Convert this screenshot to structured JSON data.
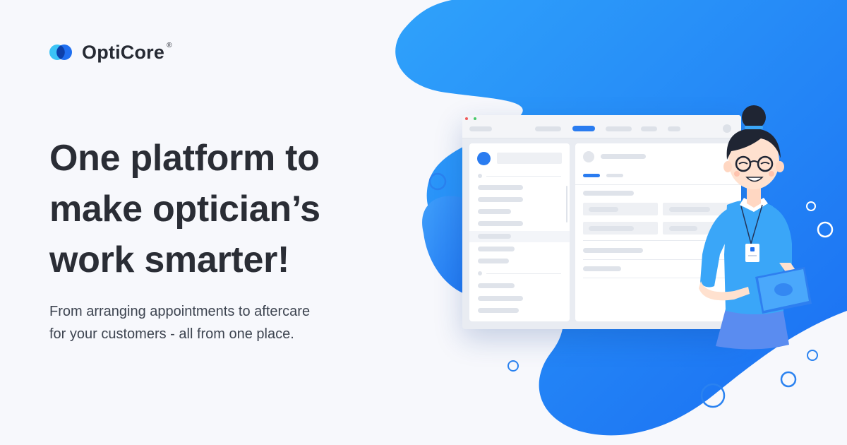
{
  "brand": {
    "name": "OptiCore",
    "registered_mark": "®",
    "logo_colors": [
      "#3bc3f5",
      "#1f6ff0"
    ]
  },
  "headline": {
    "line1": "One platform to",
    "line2": "make optician’s",
    "line3": "work smarter!"
  },
  "subheadline": {
    "line1": "From arranging appointments to aftercare",
    "line2": "for your customers - all from one place."
  },
  "colors": {
    "background": "#f7f8fc",
    "blob_light": "#3ea0fb",
    "blob_dark": "#1d78f3",
    "accent": "#2a82f0",
    "text_dark": "#2a2d35"
  },
  "illustration": {
    "subject": "optician holding tablet beside app dashboard mockup",
    "icons": [
      "opticore-logo-icon",
      "app-window-mockup",
      "optician-character",
      "tablet-icon",
      "id-badge-icon"
    ]
  }
}
